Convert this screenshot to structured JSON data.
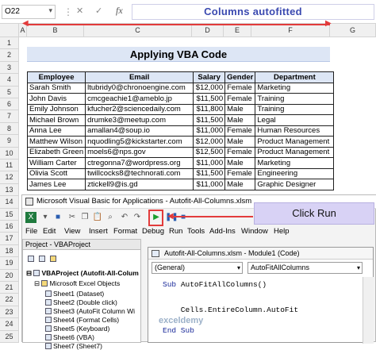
{
  "formula_bar": {
    "name_box": "O22",
    "fx": "fx",
    "annotation": "Columns autofitted"
  },
  "columns": [
    "A",
    "B",
    "C",
    "D",
    "E",
    "F",
    "G"
  ],
  "rows": [
    "1",
    "2",
    "3",
    "4",
    "5",
    "6",
    "7",
    "8",
    "9",
    "10",
    "11",
    "12",
    "13",
    "14",
    "15",
    "16",
    "17",
    "18",
    "19",
    "20",
    "21",
    "22",
    "23",
    "24",
    "25"
  ],
  "sheet_title": "Applying VBA Code",
  "table": {
    "headers": [
      "Employee",
      "Email",
      "Salary",
      "Gender",
      "Department"
    ],
    "rows": [
      [
        "Sarah Smith",
        "ltubridy0@chronoengine.com",
        "$12,000",
        "Female",
        "Marketing"
      ],
      [
        "John Davis",
        "cmcgeachie1@ameblo.jp",
        "$11,500",
        "Female",
        "Training"
      ],
      [
        "Emily Johnson",
        "kfucher2@sciencedaily.com",
        "$11,800",
        "Male",
        "Training"
      ],
      [
        "Michael Brown",
        "drumke3@meetup.com",
        "$11,500",
        "Male",
        "Legal"
      ],
      [
        "Anna Lee",
        "amallan4@soup.io",
        "$11,000",
        "Female",
        "Human Resources"
      ],
      [
        "Matthew Wilson",
        "nquodling5@kickstarter.com",
        "$12,000",
        "Male",
        "Product Management"
      ],
      [
        "Elizabeth Green",
        "moels6@nps.gov",
        "$12,500",
        "Female",
        "Product Management"
      ],
      [
        "William Carter",
        "ctregonna7@wordpress.org",
        "$11,000",
        "Male",
        "Marketing"
      ],
      [
        "Olivia Scott",
        "twillcocks8@technorati.com",
        "$11,500",
        "Female",
        "Engineering"
      ],
      [
        "James Lee",
        "ztickell9@is.gd",
        "$11,000",
        "Male",
        "Graphic Designer"
      ]
    ]
  },
  "vbe": {
    "title": "Microsoft Visual Basic for Applications - Autofit-All-Columns.xlsm",
    "menu": [
      "File",
      "Edit",
      "View",
      "Insert",
      "Format",
      "Debug",
      "Run",
      "Tools",
      "Add-Ins",
      "Window",
      "Help"
    ],
    "callout": "Click Run",
    "project": {
      "header": "Project - VBAProject",
      "root": "VBAProject (Autofit-All-Colum",
      "folder": "Microsoft Excel Objects",
      "sheets": [
        "Sheet1 (Dataset)",
        "Sheet2 (Double click)",
        "Sheet3 (AutoFit Column Wi",
        "Sheet4 (Format Cells)",
        "Sheet5 (Keyboard)",
        "Sheet6 (VBA)",
        "Sheet7 (Sheet7)"
      ]
    },
    "module": {
      "title": "Autofit-All-Columns.xlsm - Module1 (Code)",
      "combo_left": "(General)",
      "combo_right": "AutoFitAllColumns",
      "code": [
        {
          "kw": "Sub ",
          "rest": "AutoFitAllColumns()"
        },
        {
          "kw": "",
          "rest": ""
        },
        {
          "kw": "",
          "rest": "    Cells.EntireColumn.AutoFit"
        },
        {
          "kw": "",
          "rest": ""
        },
        {
          "kw": "End Sub",
          "rest": ""
        }
      ]
    },
    "watermark": "exceldemy"
  }
}
